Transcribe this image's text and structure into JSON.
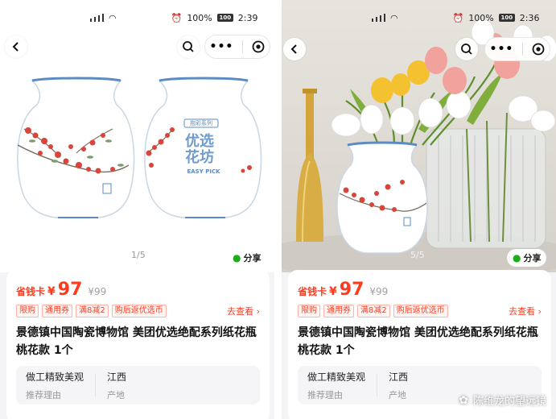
{
  "left": {
    "status": {
      "battery": "100%",
      "battery_badge": "100",
      "time": "2:39"
    },
    "vase_logo_top": "抱彩系列",
    "vase_logo_main": "优选花坊",
    "vase_logo_sub": "EASY PICK",
    "pager": "1/5",
    "share_label": "分享",
    "price": {
      "tag": "省钱卡",
      "yen": "¥",
      "current": "97",
      "original": "¥99"
    },
    "tags": [
      "限购",
      "通用券",
      "满8减2",
      "购后返优选币"
    ],
    "more_label": "去查看",
    "title": "景德镇中国陶瓷博物馆 美团优选绝配系列纸花瓶 桃花款 1个",
    "info": [
      {
        "value": "做工精致美观",
        "key": "推荐理由"
      },
      {
        "value": "江西",
        "key": "产地"
      }
    ]
  },
  "right": {
    "status": {
      "battery": "100%",
      "battery_badge": "100",
      "time": "2:36"
    },
    "pager": "5/5",
    "share_label": "分享",
    "price": {
      "tag": "省钱卡",
      "yen": "¥",
      "current": "97",
      "original": "¥99"
    },
    "tags": [
      "限购",
      "通用券",
      "满8减2",
      "购后返优选币"
    ],
    "more_label": "去查看",
    "title": "景德镇中国陶瓷博物馆 美团优选绝配系列纸花瓶 桃花款 1个",
    "info": [
      {
        "value": "做工精致美观",
        "key": "推荐理由"
      },
      {
        "value": "江西",
        "key": "产地"
      }
    ]
  },
  "watermark": "陈维龙的望远镜",
  "colors": {
    "accent": "#ff3b1f",
    "vase_blue": "#6f9ccc",
    "blossom": "#d8453a"
  }
}
